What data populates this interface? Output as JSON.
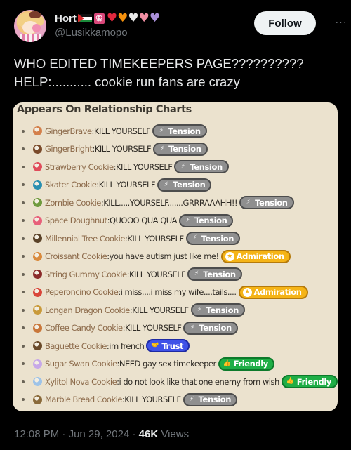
{
  "user": {
    "display_name": "Hort",
    "handle": "@Lusikkamopo",
    "name_symbol": "⚢",
    "hearts": [
      {
        "glyph": "♥",
        "color": "#e0283e"
      },
      {
        "glyph": "♥",
        "color": "#f4900c"
      },
      {
        "glyph": "♥",
        "color": "#e8e8e8"
      },
      {
        "glyph": "♥",
        "color": "#f08da2"
      },
      {
        "glyph": "♥",
        "color": "#a98fd8"
      }
    ]
  },
  "actions": {
    "follow_label": "Follow",
    "more_label": "···"
  },
  "tweet": {
    "line1": "WHO EDITED TIMEKEEPERS PAGE??????????",
    "line2": "HELP:........... cookie run fans are crazy"
  },
  "card": {
    "title": "Appears On Relationship Charts",
    "rows": [
      {
        "name": "GingerBrave",
        "quote": "KILL YOURSELF",
        "badge": "Tension",
        "type": "tension",
        "icon_color": "#d4804b"
      },
      {
        "name": "GingerBright",
        "quote": "KILL YOURSELF",
        "badge": "Tension",
        "type": "tension",
        "icon_color": "#7a4a2a"
      },
      {
        "name": "Strawberry Cookie",
        "quote": "KILL YOURSELF",
        "badge": "Tension",
        "type": "tension",
        "icon_color": "#e04c5a"
      },
      {
        "name": "Skater Cookie",
        "quote": "KILL YOURSELF",
        "badge": "Tension",
        "type": "tension",
        "icon_color": "#2a8fb0"
      },
      {
        "name": "Zombie Cookie",
        "quote": "KILL.....YOURSELF.......GRRRAAAHH!!",
        "badge": "Tension",
        "type": "tension",
        "icon_color": "#6f9a3e"
      },
      {
        "name": "Space Doughnut",
        "quote": "QUOOO QUA QUA",
        "badge": "Tension",
        "type": "tension",
        "icon_color": "#e8607a"
      },
      {
        "name": "Millennial Tree Cookie",
        "quote": "KILL YOURSELF",
        "badge": "Tension",
        "type": "tension",
        "icon_color": "#5a4228"
      },
      {
        "name": "Croissant Cookie",
        "quote": "you have autism just like me!",
        "badge": "Admiration",
        "type": "admiration",
        "icon_color": "#d98a3c"
      },
      {
        "name": "String Gummy Cookie",
        "quote": "KILL YOURSELF",
        "badge": "Tension",
        "type": "tension",
        "icon_color": "#8a2a2a"
      },
      {
        "name": "Peperoncino Cookie",
        "quote": "i miss....i miss my wife....tails....",
        "badge": "Admiration",
        "type": "admiration",
        "icon_color": "#d9463a"
      },
      {
        "name": "Longan Dragon Cookie",
        "quote": "KILL YOURSELF",
        "badge": "Tension",
        "type": "tension",
        "icon_color": "#c99a3a"
      },
      {
        "name": "Coffee Candy Cookie",
        "quote": "KILL YOURSELF",
        "badge": "Tension",
        "type": "tension",
        "icon_color": "#c9773a"
      },
      {
        "name": "Baguette Cookie",
        "quote": "im french",
        "badge": "Trust",
        "type": "trust",
        "icon_color": "#6a4a2a"
      },
      {
        "name": "Sugar Swan Cookie",
        "quote": "NEED gay sex timekeeper",
        "badge": "Friendly",
        "type": "friendly",
        "icon_color": "#c7a8e8"
      },
      {
        "name": "Xylitol Nova Cookie",
        "quote": "i do not look like that one enemy from wish",
        "badge": "Friendly",
        "type": "friendly",
        "icon_color": "#9ec3e8"
      },
      {
        "name": "Marble Bread Cookie",
        "quote": "KILL YOURSELF",
        "badge": "Tension",
        "type": "tension",
        "icon_color": "#8a6a3a"
      }
    ],
    "badge_icons": {
      "tension": "⚡",
      "admiration": "★",
      "trust": "🤝",
      "friendly": "👍"
    }
  },
  "footer": {
    "time": "12:08 PM",
    "sep1": " · ",
    "date": "Jun 29, 2024",
    "sep2": " · ",
    "views_count": "46K",
    "views_label": " Views"
  }
}
